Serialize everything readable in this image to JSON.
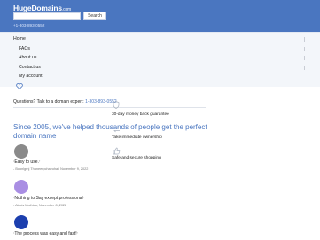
{
  "header": {
    "logo_text": "HugeDomains",
    "logo_suffix": ".com",
    "search_placeholder": "",
    "search_button": "Search",
    "phone": "+1-303-893-0552",
    "background_color": "#4a76c0"
  },
  "menu": {
    "items": [
      {
        "label": "Home"
      },
      {
        "label": "FAQs"
      },
      {
        "label": "About us"
      },
      {
        "label": "Contact us"
      },
      {
        "label": "My account"
      }
    ],
    "favorites_icon": "heart-icon"
  },
  "contact": {
    "question": "Questions? Talk to a domain expert:",
    "phone": "1-303-893-0552"
  },
  "features": [
    {
      "icon": "shield-icon",
      "label": "30-day money back guarantee"
    },
    {
      "icon": "transfer-icon",
      "label": "Take immediate ownership"
    },
    {
      "icon": "thumbs-up-icon",
      "label": "Safe and secure shopping"
    }
  ],
  "headline": "Since 2005, we've helped thousands of people get the perfect domain name",
  "testimonials": [
    {
      "quote": "Easy to use.",
      "author": "- Boonlgrnj Thaneerpchaeohai, November 9, 2022",
      "avatar_color": "#8a8a8a"
    },
    {
      "quote": "Nothing to Say except professional",
      "author": "- Alexis Mathieu, November 8, 2022",
      "avatar_color": "#a98ee3"
    },
    {
      "quote": "The process was easy and fast!",
      "author": "",
      "avatar_color": "#1c3fae"
    }
  ]
}
